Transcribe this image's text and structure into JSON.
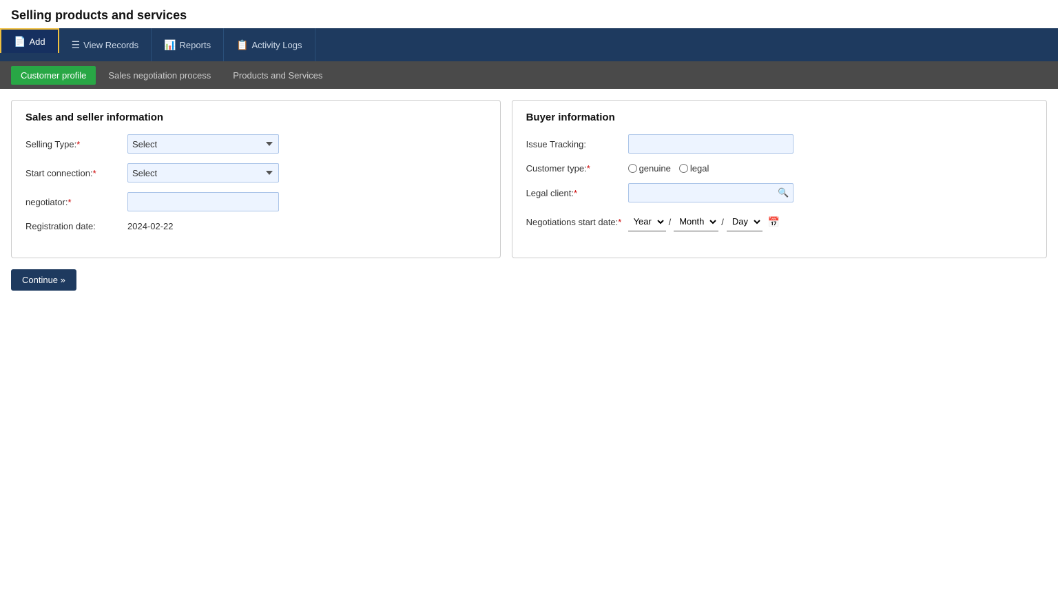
{
  "page": {
    "title": "Selling products and services"
  },
  "topNav": {
    "items": [
      {
        "id": "add",
        "label": "Add",
        "icon": "📄",
        "active": true
      },
      {
        "id": "view-records",
        "label": "View Records",
        "icon": "☰",
        "active": false
      },
      {
        "id": "reports",
        "label": "Reports",
        "icon": "📊",
        "active": false
      },
      {
        "id": "activity-logs",
        "label": "Activity Logs",
        "icon": "📋",
        "active": false
      }
    ]
  },
  "subNav": {
    "items": [
      {
        "id": "customer-profile",
        "label": "Customer profile",
        "active": true
      },
      {
        "id": "sales-negotiation",
        "label": "Sales negotiation process",
        "active": false
      },
      {
        "id": "products-services",
        "label": "Products and Services",
        "active": false
      }
    ]
  },
  "leftSection": {
    "title": "Sales and seller information",
    "fields": {
      "sellingType": {
        "label": "Selling Type:",
        "required": true,
        "placeholder": "Select",
        "options": [
          "Select"
        ]
      },
      "startConnection": {
        "label": "Start connection:",
        "required": true,
        "placeholder": "Select",
        "options": [
          "Select"
        ]
      },
      "negotiator": {
        "label": "negotiator:",
        "required": true
      },
      "registrationDate": {
        "label": "Registration date:",
        "value": "2024-02-22"
      }
    }
  },
  "rightSection": {
    "title": "Buyer information",
    "fields": {
      "issueTracking": {
        "label": "Issue Tracking:"
      },
      "customerType": {
        "label": "Customer type:",
        "required": true,
        "options": [
          {
            "value": "genuine",
            "label": "genuine"
          },
          {
            "value": "legal",
            "label": "legal"
          }
        ]
      },
      "legalClient": {
        "label": "Legal client:",
        "required": true
      },
      "negotiationsStartDate": {
        "label": "Negotiations start date:",
        "required": true,
        "yearPlaceholder": "Year",
        "monthPlaceholder": "Month",
        "dayPlaceholder": "Day"
      }
    }
  },
  "buttons": {
    "continue": "Continue »"
  }
}
